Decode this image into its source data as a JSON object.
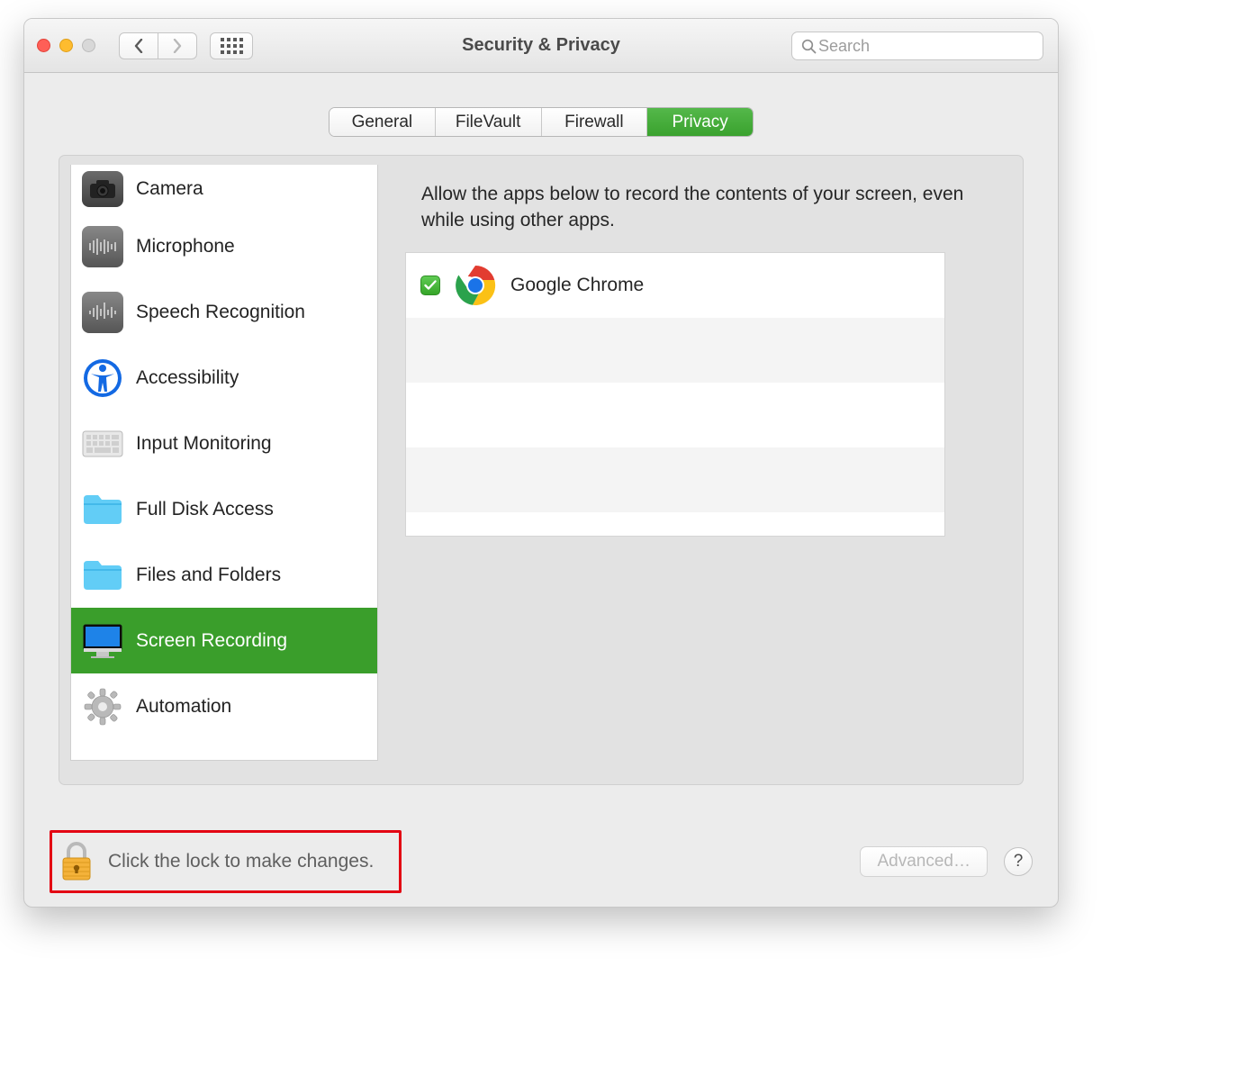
{
  "window": {
    "title": "Security & Privacy"
  },
  "search": {
    "placeholder": "Search"
  },
  "tabs": {
    "items": [
      {
        "label": "General"
      },
      {
        "label": "FileVault"
      },
      {
        "label": "Firewall"
      },
      {
        "label": "Privacy"
      }
    ],
    "active_index": 3
  },
  "sidebar": {
    "items": [
      {
        "label": "Camera",
        "icon": "camera-icon"
      },
      {
        "label": "Microphone",
        "icon": "microphone-icon"
      },
      {
        "label": "Speech Recognition",
        "icon": "speech-icon"
      },
      {
        "label": "Accessibility",
        "icon": "accessibility-icon"
      },
      {
        "label": "Input Monitoring",
        "icon": "keyboard-icon"
      },
      {
        "label": "Full Disk Access",
        "icon": "folder-icon"
      },
      {
        "label": "Files and Folders",
        "icon": "folder-icon"
      },
      {
        "label": "Screen Recording",
        "icon": "display-icon"
      },
      {
        "label": "Automation",
        "icon": "gear-icon"
      }
    ],
    "selected_index": 7
  },
  "detail": {
    "description": "Allow the apps below to record the contents of your screen, even while using other apps.",
    "apps": [
      {
        "name": "Google Chrome",
        "enabled": true,
        "icon": "chrome-icon"
      }
    ]
  },
  "footer": {
    "lock_text": "Click the lock to make changes.",
    "advanced_label": "Advanced…",
    "help_label": "?"
  }
}
